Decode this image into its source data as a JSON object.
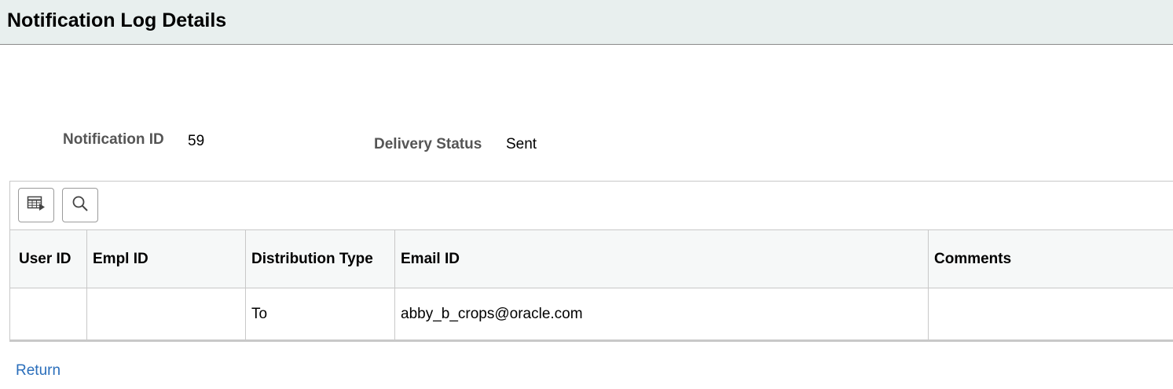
{
  "header": {
    "title": "Notification Log Details"
  },
  "fields": {
    "notification_id": {
      "label": "Notification ID",
      "value": "59"
    },
    "delivery_status": {
      "label": "Delivery Status",
      "value": "Sent"
    }
  },
  "grid": {
    "toolbar": {
      "personalize_icon": "grid-personalize-icon",
      "search_icon": "search-icon"
    },
    "columns": [
      "User ID",
      "Empl ID",
      "Distribution Type",
      "Email ID",
      "Comments"
    ],
    "rows": [
      [
        "",
        "",
        "To",
        "abby_b_crops@oracle.com",
        ""
      ]
    ]
  },
  "footer": {
    "return_label": "Return"
  }
}
